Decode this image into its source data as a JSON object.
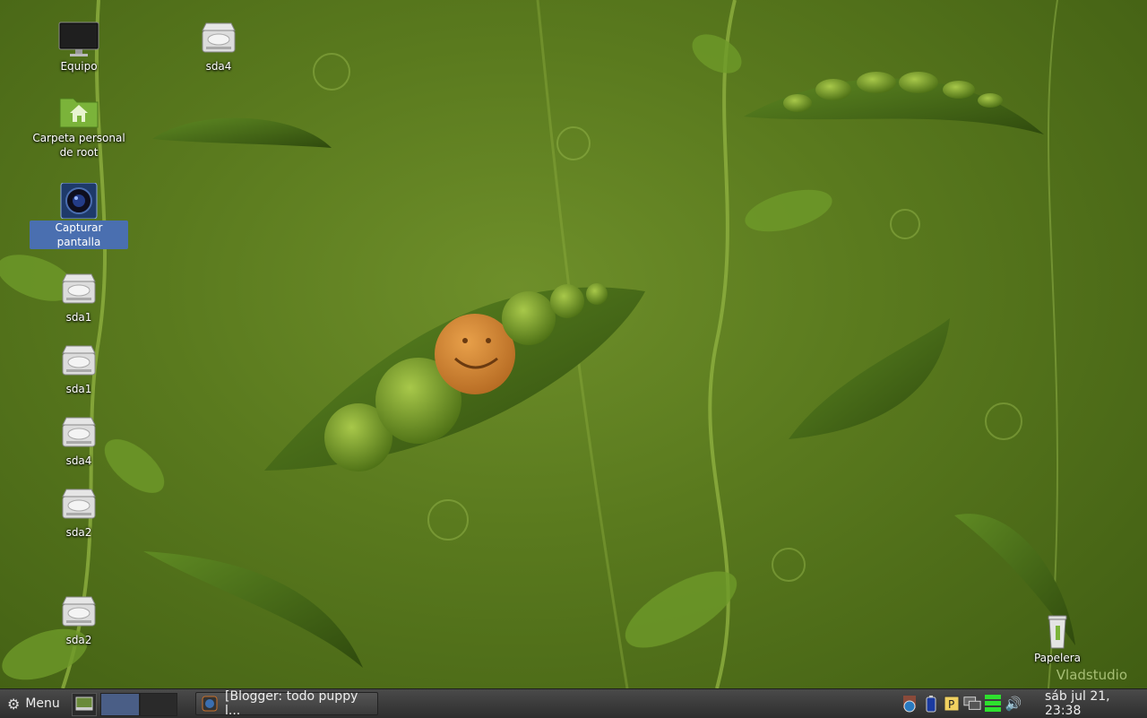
{
  "desktop": {
    "icons": [
      {
        "label": "Equipo"
      },
      {
        "label": "sda4"
      },
      {
        "label": "Carpeta personal de root"
      },
      {
        "label": "Capturar pantalla"
      },
      {
        "label": "sda1"
      },
      {
        "label": "sda1"
      },
      {
        "label": "sda4"
      },
      {
        "label": "sda2"
      },
      {
        "label": "sda2"
      },
      {
        "label": "Papelera"
      }
    ],
    "watermark": "Vladstudio"
  },
  "taskbar": {
    "menu_label": "Menu",
    "task_label": "[Blogger: todo puppy l...",
    "clock": "sáb jul 21, 23:38",
    "tray_icons": [
      "network-globe-icon",
      "package-icon",
      "battery-icon",
      "p-icon",
      "monitor-icon",
      "green-bars-icon",
      "volume-icon"
    ]
  }
}
